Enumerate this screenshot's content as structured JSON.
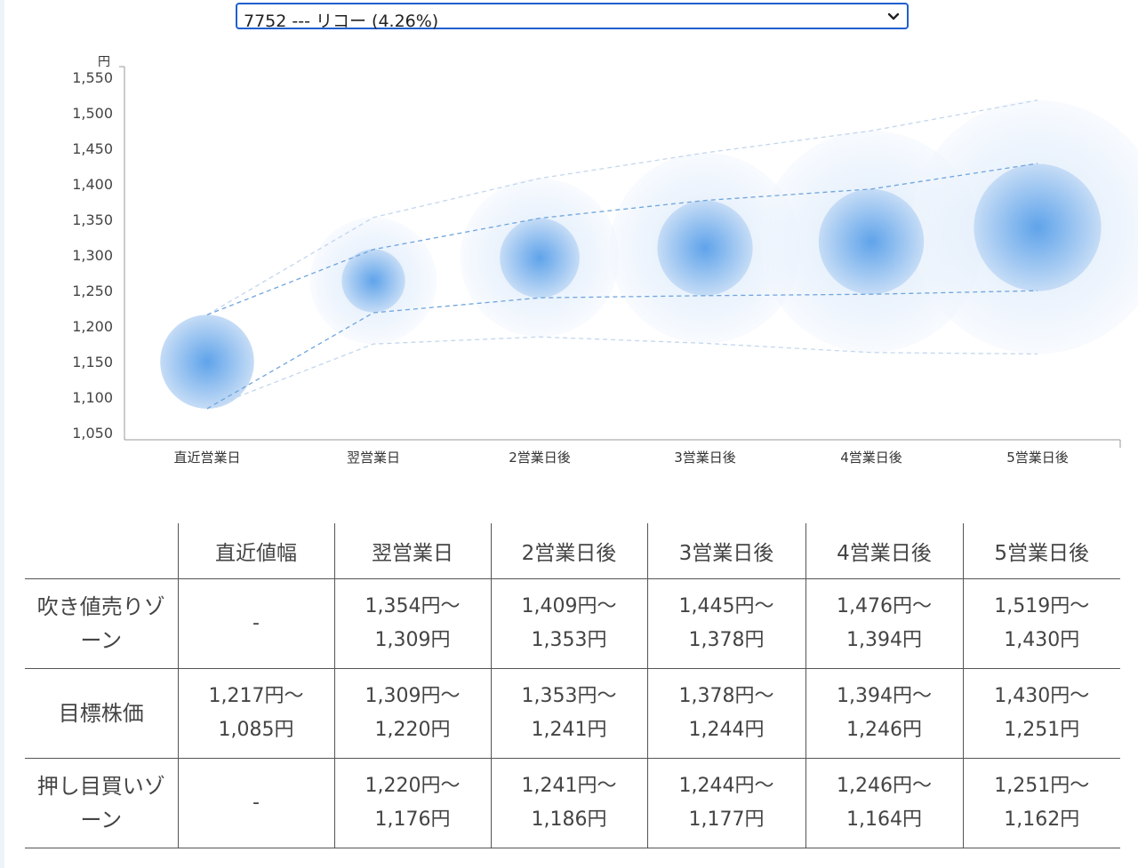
{
  "selector": {
    "value": "7752 --- リコー (4.26%)"
  },
  "chart_data": {
    "type": "scatter",
    "title": "",
    "ylabel": "円",
    "xlabel": "",
    "ylim": [
      1050,
      1550
    ],
    "yticks": [
      1050,
      1100,
      1150,
      1200,
      1250,
      1300,
      1350,
      1400,
      1450,
      1500,
      1550
    ],
    "ytick_labels": [
      "1,050",
      "1,100",
      "1,150",
      "1,200",
      "1,250",
      "1,300",
      "1,350",
      "1,400",
      "1,450",
      "1,500",
      "1,550"
    ],
    "categories": [
      "直近営業日",
      "翌営業日",
      "2営業日後",
      "3営業日後",
      "4営業日後",
      "5営業日後"
    ],
    "series": [
      {
        "name": "",
        "values": [
          1151,
          1265,
          1297,
          1311,
          1320,
          1340
        ]
      }
    ],
    "target_high": [
      1217,
      1309,
      1353,
      1378,
      1394,
      1430
    ],
    "target_low": [
      1085,
      1220,
      1241,
      1244,
      1246,
      1251
    ],
    "sell_zone_high": [
      null,
      1354,
      1409,
      1445,
      1476,
      1519
    ],
    "buy_zone_low": [
      null,
      1176,
      1186,
      1177,
      1164,
      1162
    ],
    "colors": {
      "bubble": "#4a90e2",
      "axis": "#999999"
    },
    "grid": false
  },
  "table": {
    "headers": [
      "",
      "直近値幅",
      "翌営業日",
      "2営業日後",
      "3営業日後",
      "4営業日後",
      "5営業日後"
    ],
    "rows": [
      {
        "label": "吹き値売りゾーン",
        "label_lines": [
          "吹き値売りゾ",
          "ーン"
        ],
        "cells": [
          [
            "-"
          ],
          [
            "1,354円〜",
            "1,309円"
          ],
          [
            "1,409円〜",
            "1,353円"
          ],
          [
            "1,445円〜",
            "1,378円"
          ],
          [
            "1,476円〜",
            "1,394円"
          ],
          [
            "1,519円〜",
            "1,430円"
          ]
        ]
      },
      {
        "label": "目標株価",
        "label_lines": [
          "目標株価"
        ],
        "cells": [
          [
            "1,217円〜",
            "1,085円"
          ],
          [
            "1,309円〜",
            "1,220円"
          ],
          [
            "1,353円〜",
            "1,241円"
          ],
          [
            "1,378円〜",
            "1,244円"
          ],
          [
            "1,394円〜",
            "1,246円"
          ],
          [
            "1,430円〜",
            "1,251円"
          ]
        ]
      },
      {
        "label": "押し目買いゾーン",
        "label_lines": [
          "押し目買いゾ",
          "ーン"
        ],
        "cells": [
          [
            "-"
          ],
          [
            "1,220円〜",
            "1,176円"
          ],
          [
            "1,241円〜",
            "1,186円"
          ],
          [
            "1,244円〜",
            "1,177円"
          ],
          [
            "1,246円〜",
            "1,164円"
          ],
          [
            "1,251円〜",
            "1,162円"
          ]
        ]
      }
    ]
  }
}
